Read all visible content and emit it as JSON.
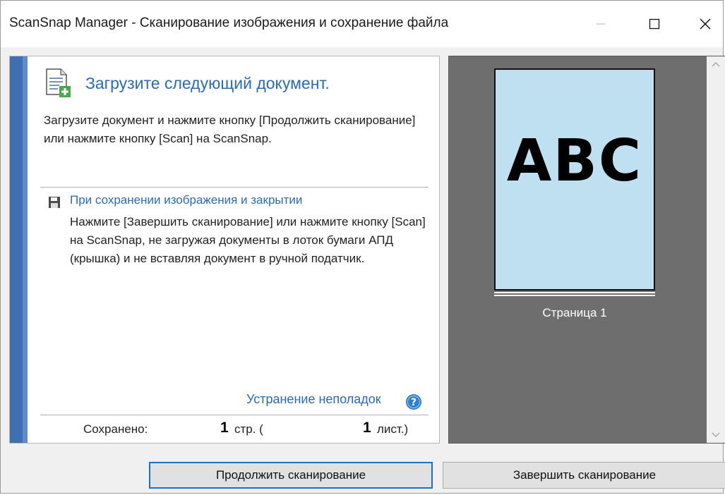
{
  "window": {
    "title": "ScanSnap Manager - Сканирование изображения и сохранение файла",
    "controls": {
      "minimize": "minimize",
      "maximize": "maximize",
      "close": "close"
    }
  },
  "instruction": {
    "icon": "document-add-icon",
    "heading": "Загрузите следующий документ.",
    "description": "Загрузите документ и нажмите кнопку [Продолжить сканирование] или нажмите кнопку [Scan] на ScanSnap."
  },
  "save_section": {
    "icon": "floppy-disk-icon",
    "heading": "При сохранении изображения и закрытии",
    "description": "Нажмите [Завершить сканирование] или нажмите кнопку [Scan] на ScanSnap, не загружая документы в лоток бумаги АПД (крышка) и не вставляя документ в ручной податчик."
  },
  "troubleshooting": {
    "label": "Устранение неполадок",
    "icon": "help-icon"
  },
  "status": {
    "saved_label": "Сохранено:",
    "pages_count": "1",
    "pages_unit": "стр. (",
    "sheets_count": "1",
    "sheets_unit": "лист.)"
  },
  "preview": {
    "page_text": "ABC",
    "page_caption": "Страница 1",
    "page_color": "#bfe0f1",
    "background_color": "#6e6e6e"
  },
  "buttons": {
    "continue": "Продолжить сканирование",
    "finish": "Завершить сканирование"
  },
  "colors": {
    "accent": "#2a6bb8",
    "sidebar": "#3f6fb0"
  }
}
